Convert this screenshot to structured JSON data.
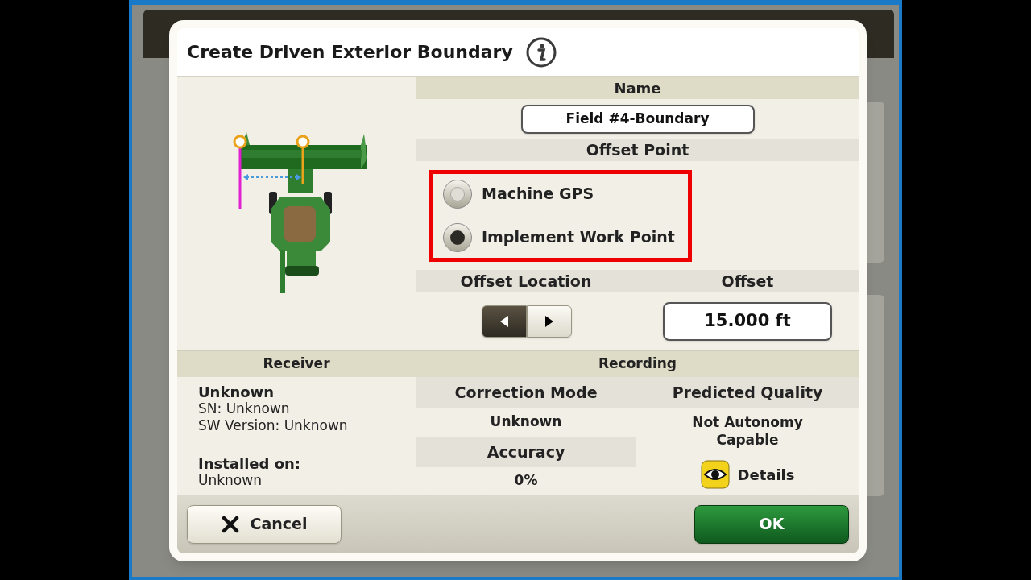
{
  "dialog": {
    "title": "Create Driven Exterior Boundary",
    "name": {
      "header": "Name",
      "value": "Field #4-Boundary"
    },
    "offset_point": {
      "header": "Offset Point",
      "options": [
        {
          "label": "Machine GPS",
          "selected": false
        },
        {
          "label": "Implement Work Point",
          "selected": true
        }
      ]
    },
    "offset_location": {
      "header": "Offset Location",
      "arrows": [
        {
          "kind": "left",
          "selected": true
        },
        {
          "kind": "right",
          "selected": false
        }
      ]
    },
    "offset": {
      "header": "Offset",
      "value": "15.000 ft"
    },
    "receiver": {
      "header": "Receiver",
      "name": "Unknown",
      "sn": "SN: Unknown",
      "sw_version": "SW Version: Unknown",
      "installed_on_label": "Installed on:",
      "installed_on": "Unknown"
    },
    "recording": {
      "header": "Recording",
      "correction_mode": {
        "header": "Correction Mode",
        "value": "Unknown"
      },
      "accuracy": {
        "header": "Accuracy",
        "value": "0%"
      },
      "predicted_quality": {
        "header": "Predicted Quality",
        "value": "Not Autonomy Capable"
      },
      "details_button": "Details"
    },
    "buttons": {
      "cancel": "Cancel",
      "ok": "OK"
    }
  }
}
